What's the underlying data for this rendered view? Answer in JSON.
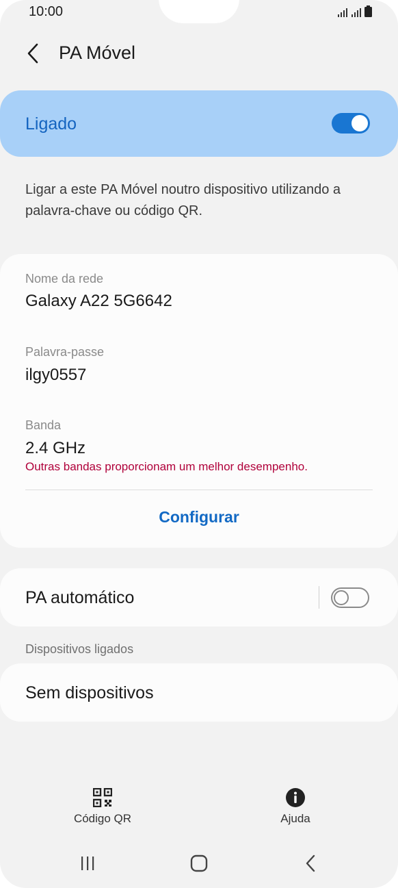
{
  "status_bar": {
    "time": "10:00"
  },
  "header": {
    "title": "PA Móvel"
  },
  "master_switch": {
    "label": "Ligado",
    "state": "on"
  },
  "description": "Ligar a este PA Móvel noutro dispositivo utilizando a palavra-chave ou código QR.",
  "network": {
    "name_label": "Nome da rede",
    "name_value": "Galaxy A22 5G6642",
    "password_label": "Palavra-passe",
    "password_value": "ilgy0557",
    "band_label": "Banda",
    "band_value": "2.4 GHz",
    "band_warning": "Outras bandas proporcionam um melhor desempenho.",
    "configure_label": "Configurar"
  },
  "auto_hotspot": {
    "label": "PA automático",
    "state": "off"
  },
  "connected_devices": {
    "section_label": "Dispositivos ligados",
    "empty_label": "Sem dispositivos"
  },
  "bottom_actions": {
    "qr_label": "Código QR",
    "help_label": "Ajuda"
  },
  "colors": {
    "accent": "#1976d2",
    "highlight_card": "#a8d0f8",
    "warning": "#b0003a"
  }
}
